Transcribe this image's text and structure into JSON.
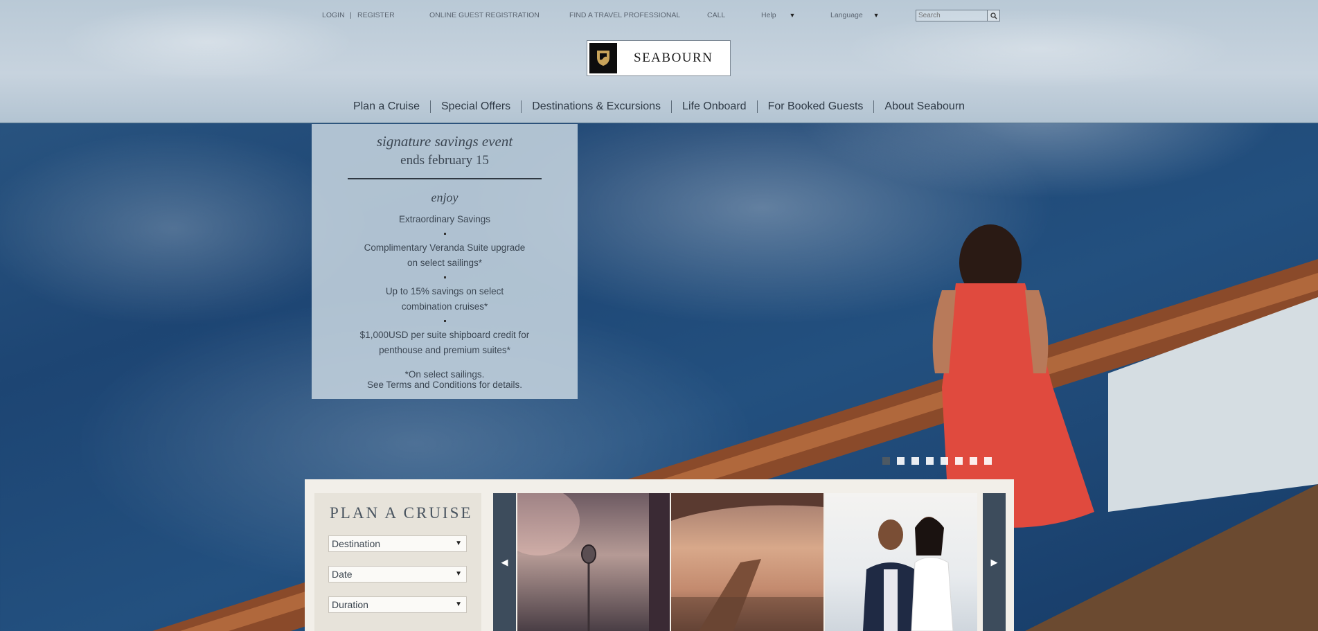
{
  "utility_nav": {
    "login": "LOGIN",
    "separator": "|",
    "register": "REGISTER",
    "online_registration": "ONLINE GUEST REGISTRATION",
    "find_travel_pro": "FIND A TRAVEL PROFESSIONAL",
    "call": "CALL",
    "help": "Help",
    "language": "Language",
    "search_placeholder": "Search"
  },
  "brand": {
    "name": "SEABOURN"
  },
  "main_nav": [
    "Plan a Cruise",
    "Special Offers",
    "Destinations & Excursions",
    "Life Onboard",
    "For Booked Guests",
    "About Seabourn"
  ],
  "promo": {
    "title": "signature savings event",
    "subtitle": "ends february 15",
    "enjoy": "enjoy",
    "benefit_1": "Extraordinary Savings",
    "benefit_2a": "Complimentary Veranda Suite upgrade",
    "benefit_2b": "on select sailings*",
    "benefit_3a": "Up to 15% savings on select",
    "benefit_3b": "combination cruises*",
    "benefit_4a": "$1,000USD per suite shipboard credit for",
    "benefit_4b": "penthouse and premium suites*",
    "terms_a": "*On select sailings.",
    "terms_b": "See Terms and Conditions for details."
  },
  "slider": {
    "total": 8,
    "active": 1
  },
  "plan": {
    "title": "PLAN A CRUISE",
    "destination": "Destination",
    "date": "Date",
    "duration": "Duration"
  },
  "colors": {
    "accent": "#3d4c5c",
    "card_bg": "#f2efe9"
  },
  "icons": {
    "dropdown": "triangle-down",
    "search": "magnifier",
    "prev": "triangle-left",
    "next": "triangle-right"
  }
}
